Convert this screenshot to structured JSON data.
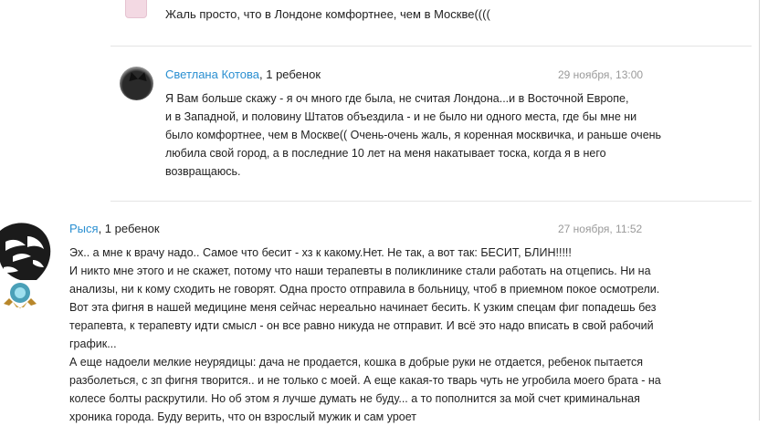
{
  "top_comment": {
    "text": "Жаль просто, что в Лондоне комфортнее, чем в Москве(((("
  },
  "comments": [
    {
      "author": "Светлана Котова",
      "meta": ", 1 ребенок",
      "date": "29 ноября, 13:00",
      "lines": [
        "Я Вам больше скажу - я оч много где была, не считая Лондона...и в Восточной Европе,",
        "и в Западной, и половину Штатов объездила - и не было ни одного места, где бы мне ни",
        "было комфортнее, чем в Москве(( Очень-очень жаль, я коренная москвичка, и раньше очень",
        "любила свой город, а в последние 10 лет на меня накатывает тоска, когда я в него",
        "возвращаюсь."
      ]
    },
    {
      "author": "Рыся",
      "meta": ", 1 ребенок",
      "date": "27 ноября, 11:52",
      "lines": [
        "Эх.. а мне к врачу надо.. Самое что бесит - хз к какому.Нет. Не так, а вот так: БЕСИТ, БЛИН!!!!!",
        "И никто мне этого и не скажет, потому что наши терапевты в поликлинике стали работать на отцепись. Ни на",
        "анализы, ни к кому сходить не говорят. Одна просто отправила в больницу, чтоб в приемном покое осмотрели.",
        "Вот эта фигня в нашей медицине меня сейчас нереально начинает бесить. К узким спецам фиг попадешь без",
        "терапевта, к терапевту идти смысл - он все равно никуда не отправит. И всё это надо вписать в свой рабочий",
        "график...",
        "А еще надоели мелкие неурядицы: дача не продается, кошка в добрые руки не отдается, ребенок пытается",
        "разболеться, с зп фигня творится.. и не только с моей. А еще какая-то тварь чуть не угробила моего брата - на",
        "колесе болты раскрутили. Но об этом я лучше думать не буду... а то пополнится за мой счет криминальная",
        "хроника города. Буду верить, что он взрослый мужик и сам уроет"
      ]
    }
  ]
}
